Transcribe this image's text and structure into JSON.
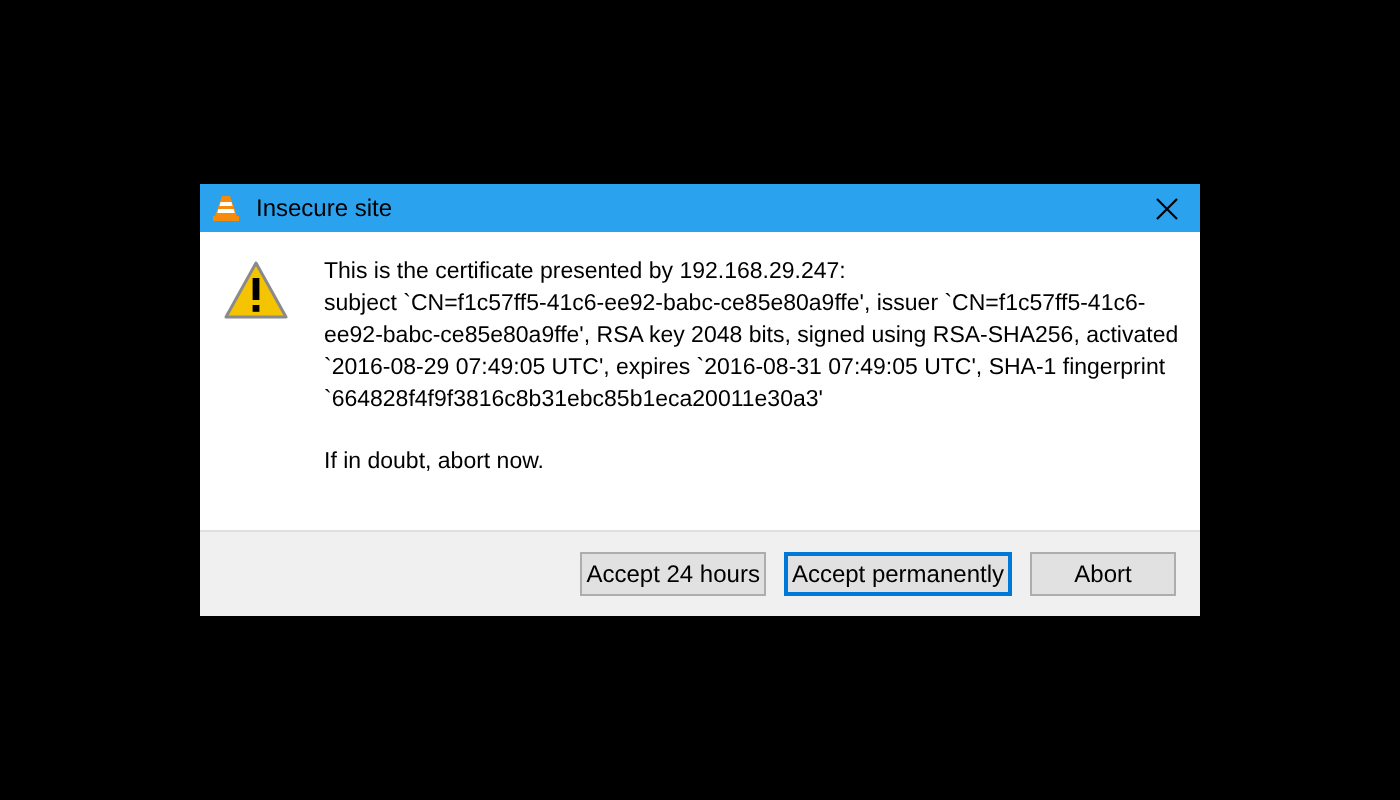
{
  "window": {
    "title": "Insecure site"
  },
  "message": {
    "lines": [
      "This is the certificate presented by 192.168.29.247:",
      "subject `CN=f1c57ff5-41c6-ee92-babc-ce85e80a9ffe', issuer `CN=f1c57ff5-41c6-",
      "ee92-babc-ce85e80a9ffe', RSA key 2048 bits, signed using RSA-SHA256, activated",
      "`2016-08-29 07:49:05 UTC', expires `2016-08-31 07:49:05 UTC', SHA-1 fingerprint",
      "`664828f4f9f3816c8b31ebc85b1eca20011e30a3'"
    ],
    "advice": "If in doubt, abort now."
  },
  "buttons": [
    {
      "label": "Accept 24 hours",
      "focused": false
    },
    {
      "label": "Accept permanently",
      "focused": true
    },
    {
      "label": "Abort",
      "focused": false
    }
  ]
}
